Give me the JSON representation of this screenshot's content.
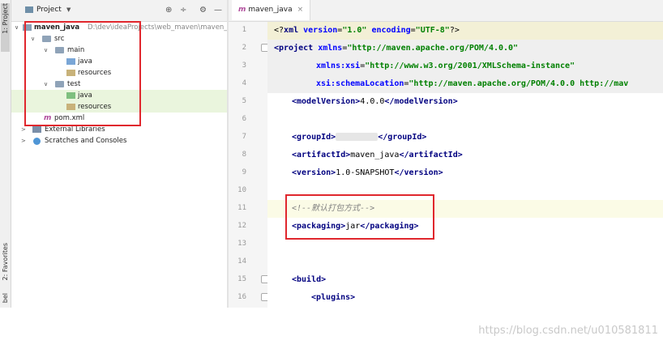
{
  "side_strip": {
    "project_tab": "1: Project",
    "favorites_tab": "2: Favorites",
    "structure_tab": "bel"
  },
  "project_panel": {
    "title": "Project",
    "tree": {
      "root_name": "maven_java",
      "root_path": "D:\\dev\\ideaProjects\\web_maven\\maven_j",
      "src": "src",
      "main": "main",
      "main_java": "java",
      "main_resources": "resources",
      "test": "test",
      "test_java": "java",
      "test_resources": "resources",
      "pom": "pom.xml",
      "external_libraries": "External Libraries",
      "scratches": "Scratches and Consoles"
    }
  },
  "editor": {
    "tab_label": "maven_java",
    "line_numbers": [
      "1",
      "2",
      "3",
      "4",
      "5",
      "6",
      "7",
      "8",
      "9",
      "10",
      "11",
      "12",
      "13",
      "14",
      "15",
      "16"
    ],
    "code": {
      "l1_open": "<?",
      "l1_xml": "xml",
      "l1_version_attr": "version",
      "l1_version_val": "\"1.0\"",
      "l1_encoding_attr": "encoding",
      "l1_encoding_val": "\"UTF-8\"",
      "l1_close": "?>",
      "l2_tag": "<project",
      "l2_attr": "xmlns",
      "l2_val": "\"http://maven.apache.org/POM/4.0.0\"",
      "l3_attr": "xmlns:xsi",
      "l3_val": "\"http://www.w3.org/2001/XMLSchema-instance\"",
      "l4_attr": "xsi:schemaLocation",
      "l4_val": "\"http://maven.apache.org/POM/4.0.0 http://mav",
      "l5_open": "<modelVersion>",
      "l5_text": "4.0.0",
      "l5_close": "</modelVersion>",
      "l7_open": "<groupId>",
      "l7_close": "</groupId>",
      "l8_open": "<artifactId>",
      "l8_text": "maven_java",
      "l8_close": "</artifactId>",
      "l9_open": "<version>",
      "l9_text": "1.0-SNAPSHOT",
      "l9_close": "</version>",
      "l11_comment": "<!--默认打包方式-->",
      "l12_open": "<packaging>",
      "l12_text": "jar",
      "l12_close": "</packaging>",
      "l15_tag": "<build>",
      "l16_tag": "<plugins>"
    }
  },
  "watermark": "https://blog.csdn.net/u010581811"
}
